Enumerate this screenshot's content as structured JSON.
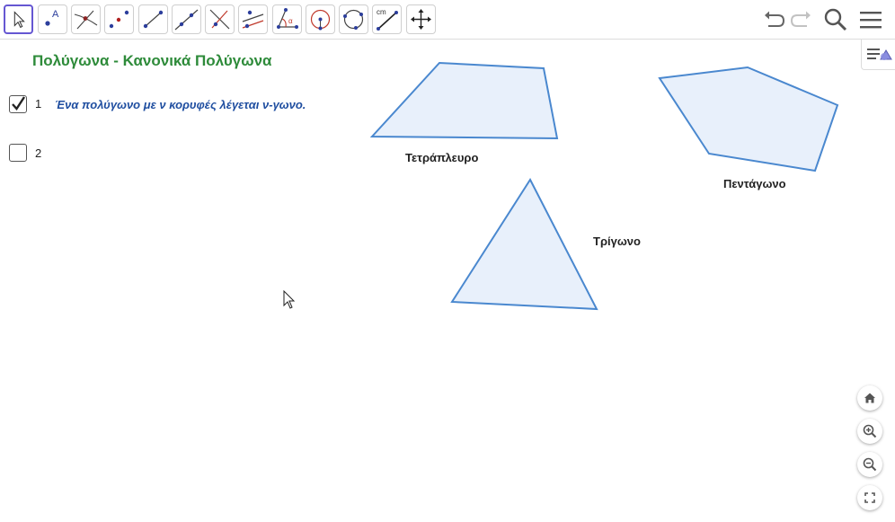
{
  "applet": {
    "title": "Πολύγωνα - Κανονικά Πολύγωνα"
  },
  "checkboxes": [
    {
      "label": "1",
      "checked": true
    },
    {
      "label": "2",
      "checked": false
    }
  ],
  "caption": "Ένα πολύγωνο με ν κορυφές λέγεται ν-γωνο.",
  "shapes": {
    "quadrilateral": "Τετράπλευρο",
    "pentagon": "Πεντάγωνο",
    "triangle": "Τρίγωνο"
  },
  "toolbar": {
    "tools": [
      "move-icon",
      "point-icon",
      "intersect-icon",
      "midpoint-icon",
      "segment-icon",
      "line-icon",
      "perpendicular-icon",
      "parallel-icon",
      "angle-icon",
      "circle-icon",
      "circle-three-points-icon",
      "ruler-icon",
      "move-graphics-icon"
    ],
    "ruler_unit": "cm",
    "angle_symbol": "α"
  },
  "colors": {
    "polygon_stroke": "#4a88cf",
    "polygon_fill": "#e8f0fb",
    "title": "#2e8b3a",
    "caption": "#1f4ea0",
    "active_tool": "#6557d2"
  }
}
